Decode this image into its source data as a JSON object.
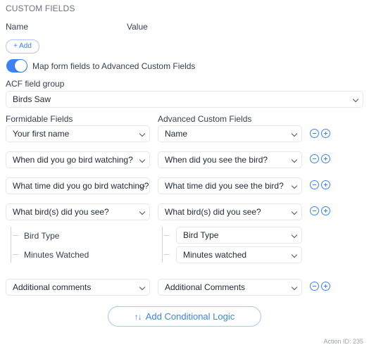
{
  "section_title": "CUSTOM FIELDS",
  "custom_fields": {
    "name_header": "Name",
    "value_header": "Value",
    "add_label": "+ Add"
  },
  "acf_toggle": {
    "label": "Map form fields to Advanced Custom Fields",
    "enabled": true
  },
  "acf_group": {
    "label": "ACF field group",
    "value": "Birds Saw"
  },
  "mapping": {
    "formidable_header": "Formidable Fields",
    "acf_header": "Advanced Custom Fields",
    "rows": [
      {
        "formidable": "Your first name",
        "acf": "Name"
      },
      {
        "formidable": "When did you go bird watching?",
        "acf": "When did you see the bird?"
      },
      {
        "formidable": "What time did you go bird watching?",
        "acf": "What time did you see the bird?"
      },
      {
        "formidable": "What bird(s) did you see?",
        "acf": "What bird(s) did you see?"
      },
      {
        "formidable": "Additional comments",
        "acf": "Additional Comments"
      }
    ],
    "subfields": [
      {
        "formidable": "Bird Type",
        "acf": "Bird Type"
      },
      {
        "formidable": "Minutes Watched",
        "acf": "Minutes watched"
      }
    ],
    "icons": {
      "remove": "minus-circle-icon",
      "add": "plus-circle-icon"
    }
  },
  "conditional_logic": {
    "icon": "↑↓",
    "label": "Add Conditional Logic"
  },
  "action_id": "Action ID: 235",
  "colors": {
    "accent": "#3b82f6",
    "border": "#e5e7eb",
    "muted": "#6b7280"
  }
}
